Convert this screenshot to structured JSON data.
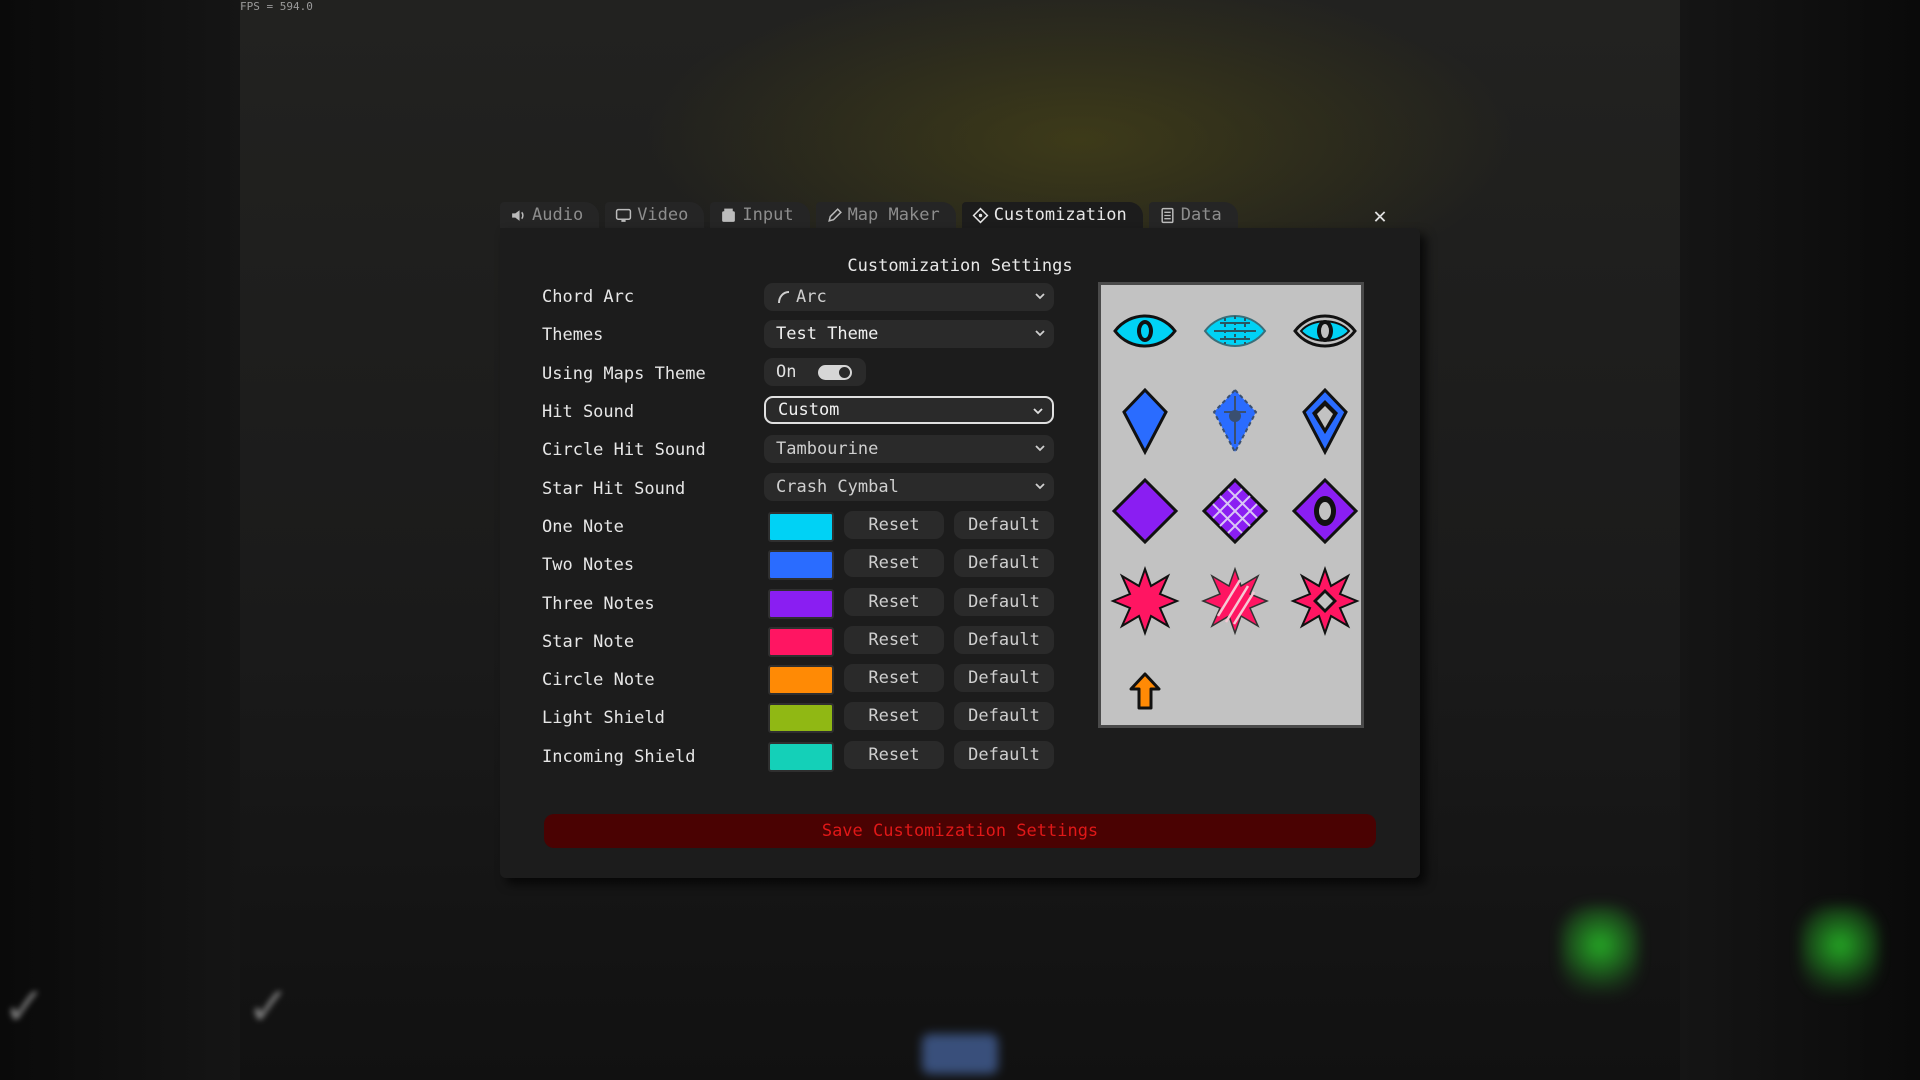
{
  "fps": "FPS = 594.0",
  "tabs": [
    {
      "label": "Audio",
      "icon": "speaker-icon"
    },
    {
      "label": "Video",
      "icon": "monitor-icon"
    },
    {
      "label": "Input",
      "icon": "keyboard-icon"
    },
    {
      "label": "Map Maker",
      "icon": "pencil-icon"
    },
    {
      "label": "Customization",
      "icon": "diamond-icon",
      "active": true
    },
    {
      "label": "Data",
      "icon": "document-icon"
    }
  ],
  "close_label": "✕",
  "panel": {
    "title": "Customization Settings",
    "chord_arc": {
      "label": "Chord Arc",
      "value": "Arc"
    },
    "themes": {
      "label": "Themes",
      "value": "Test Theme"
    },
    "using_maps_theme": {
      "label": "Using Maps Theme",
      "value": "On",
      "enabled": true
    },
    "hit_sound": {
      "label": "Hit Sound",
      "value": "Custom"
    },
    "circle_hit_sound": {
      "label": "Circle Hit Sound",
      "value": "Tambourine"
    },
    "star_hit_sound": {
      "label": "Star Hit Sound",
      "value": "Crash Cymbal"
    },
    "reset_label": "Reset",
    "default_label": "Default",
    "colors": [
      {
        "label": "One Note",
        "color": "#00d2f5"
      },
      {
        "label": "Two Notes",
        "color": "#2a6cff"
      },
      {
        "label": "Three Notes",
        "color": "#8a1ef2"
      },
      {
        "label": "Star Note",
        "color": "#ff1562"
      },
      {
        "label": "Circle Note",
        "color": "#ff8a05"
      },
      {
        "label": "Light Shield",
        "color": "#90b814"
      },
      {
        "label": "Incoming Shield",
        "color": "#14d0b8"
      }
    ],
    "save_label": "Save Customization Settings"
  },
  "preview": {
    "notes": [
      {
        "shape": "eye-icon",
        "color": "#00d2f5"
      },
      {
        "shape": "eye-striped-icon",
        "color": "#00d2f5"
      },
      {
        "shape": "eye-outline-icon",
        "color": "#00d2f5"
      },
      {
        "shape": "kite-icon",
        "color": "#2a6cff"
      },
      {
        "shape": "kite-dotted-icon",
        "color": "#2a6cff"
      },
      {
        "shape": "kite-outline-icon",
        "color": "#2a6cff"
      },
      {
        "shape": "diamond-icon",
        "color": "#8a1ef2"
      },
      {
        "shape": "diamond-grid-icon",
        "color": "#8a1ef2"
      },
      {
        "shape": "diamond-outline-icon",
        "color": "#8a1ef2"
      },
      {
        "shape": "star-burst-icon",
        "color": "#ff1562"
      },
      {
        "shape": "star-burst-striped-icon",
        "color": "#ff1562"
      },
      {
        "shape": "star-burst-outline-icon",
        "color": "#ff1562"
      },
      {
        "shape": "arrow-up-icon",
        "color": "#ff8a05"
      }
    ]
  }
}
